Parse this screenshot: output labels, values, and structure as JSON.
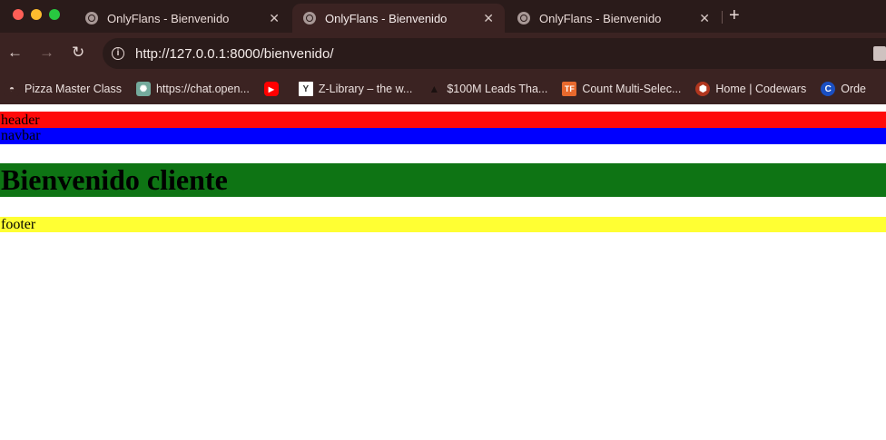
{
  "browser": {
    "tabs": [
      {
        "title": "OnlyFlans - Bienvenido",
        "active": false
      },
      {
        "title": "OnlyFlans - Bienvenido",
        "active": true
      },
      {
        "title": "OnlyFlans - Bienvenido",
        "active": false
      }
    ],
    "url": "http://127.0.0.1:8000/bienvenido/",
    "bookmarks": [
      {
        "label": "Pizza Master Class",
        "icon": "pizza-icon"
      },
      {
        "label": "https://chat.open...",
        "icon": "chatgpt-icon"
      },
      {
        "label": "",
        "icon": "youtube-icon"
      },
      {
        "label": "Z-Library – the w...",
        "icon": "zlibrary-icon"
      },
      {
        "label": "$100M Leads Tha...",
        "icon": "triangle-icon"
      },
      {
        "label": "Count Multi-Selec...",
        "icon": "tf-icon"
      },
      {
        "label": "Home | Codewars",
        "icon": "codewars-icon"
      },
      {
        "label": "Orde",
        "icon": "c-icon"
      }
    ],
    "colors": {
      "chrome_dark": "#2a1b1a",
      "chrome": "#3b2322"
    }
  },
  "page": {
    "header": "header",
    "navbar": "navbar",
    "main_heading": "Bienvenido cliente",
    "footer": "footer",
    "colors": {
      "header": "#ff0a0a",
      "navbar": "#0000ff",
      "main": "#0e7414",
      "footer": "#ffff33"
    }
  }
}
